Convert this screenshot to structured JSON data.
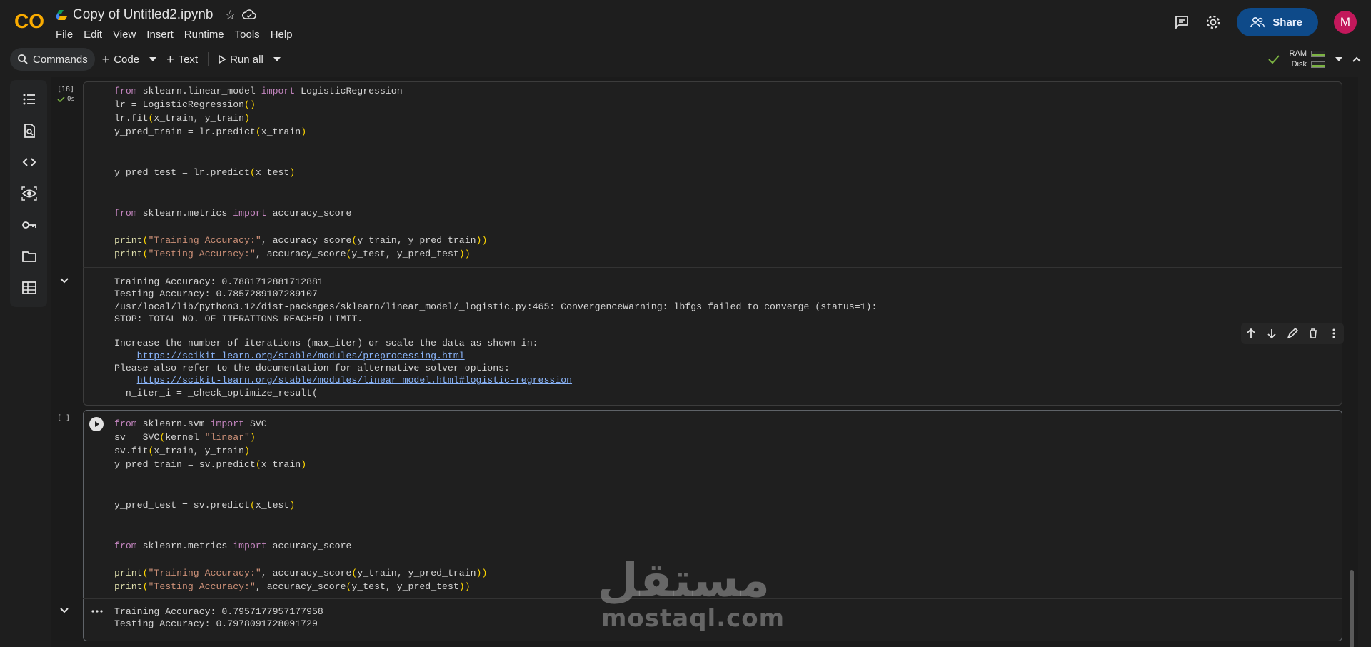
{
  "header": {
    "logo_text": "CO",
    "notebook_title": "Copy of Untitled2.ipynb",
    "menu": [
      "File",
      "Edit",
      "View",
      "Insert",
      "Runtime",
      "Tools",
      "Help"
    ],
    "share_label": "Share",
    "avatar_letter": "M"
  },
  "toolbar": {
    "commands_label": "Commands",
    "code_label": "Code",
    "text_label": "Text",
    "run_all_label": "Run all",
    "ram_label": "RAM",
    "disk_label": "Disk"
  },
  "cells": [
    {
      "exec_count": "[18]",
      "exec_time": "0s",
      "code_lines": [
        "from sklearn.linear_model import LogisticRegression",
        "lr = LogisticRegression()",
        "lr.fit(x_train, y_train)",
        "y_pred_train = lr.predict(x_train)",
        "",
        "",
        "y_pred_test = lr.predict(x_test)",
        "",
        "",
        "from sklearn.metrics import accuracy_score",
        "",
        "print(\"Training Accuracy:\", accuracy_score(y_train, y_pred_train))",
        "print(\"Testing Accuracy:\", accuracy_score(y_test, y_pred_test))"
      ],
      "output": {
        "line1": "Training Accuracy: 0.7881712881712881",
        "line2": "Testing Accuracy: 0.7857289107289107",
        "line3": "/usr/local/lib/python3.12/dist-packages/sklearn/linear_model/_logistic.py:465: ConvergenceWarning: lbfgs failed to converge (status=1):",
        "line4": "STOP: TOTAL NO. OF ITERATIONS REACHED LIMIT.",
        "line5": "Increase the number of iterations (max_iter) or scale the data as shown in:",
        "link1": "https://scikit-learn.org/stable/modules/preprocessing.html",
        "line6": "Please also refer to the documentation for alternative solver options:",
        "link2": "https://scikit-learn.org/stable/modules/linear_model.html#logistic-regression",
        "line7": "  n_iter_i = _check_optimize_result("
      }
    },
    {
      "exec_count": "[ ]",
      "output": {
        "line1": "Training Accuracy: 0.7957177957177958",
        "line2": "Testing Accuracy: 0.7978091728091729"
      }
    }
  ],
  "watermark": {
    "arabic": "مستقل",
    "latin": "mostaql.com"
  },
  "colors": {
    "share_button": "#0e4a89",
    "avatar": "#c2185b",
    "keyword": "#c586c0",
    "string": "#ce9178",
    "bracket": "#ffd700",
    "link": "#8ab4f8",
    "status_ok": "#7cb342"
  }
}
